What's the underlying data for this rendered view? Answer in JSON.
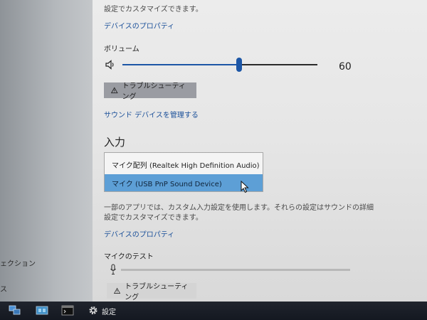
{
  "sidebar": {
    "items": [
      {
        "label": "ェクション"
      },
      {
        "label": "ス"
      }
    ]
  },
  "output": {
    "desc_line": "設定でカスタマイズできます。",
    "device_properties_link": "デバイスのプロパティ",
    "volume_label": "ボリューム",
    "volume_value": "60",
    "volume_level": 0.6,
    "troubleshoot_label": "トラブルシューティング",
    "manage_link": "サウンド デバイスを管理する"
  },
  "input": {
    "heading": "入力",
    "device_options": [
      {
        "label": "マイク配列 (Realtek High Definition Audio)"
      },
      {
        "label": "マイク (USB PnP Sound Device)"
      }
    ],
    "selected_index": 1,
    "desc_line1": "一部のアプリでは、カスタム入力設定を使用します。それらの設定はサウンドの詳細",
    "desc_line2": "設定でカスタマイズできます。",
    "device_properties_link": "デバイスのプロパティ",
    "mic_test_label": "マイクのテスト",
    "mic_level": 0,
    "troubleshoot_label": "トラブルシューティング"
  },
  "taskbar": {
    "settings_label": "設定"
  },
  "colors": {
    "accent": "#1c56a6",
    "link": "#1a4f99",
    "selected_option": "#5d9fd6"
  }
}
